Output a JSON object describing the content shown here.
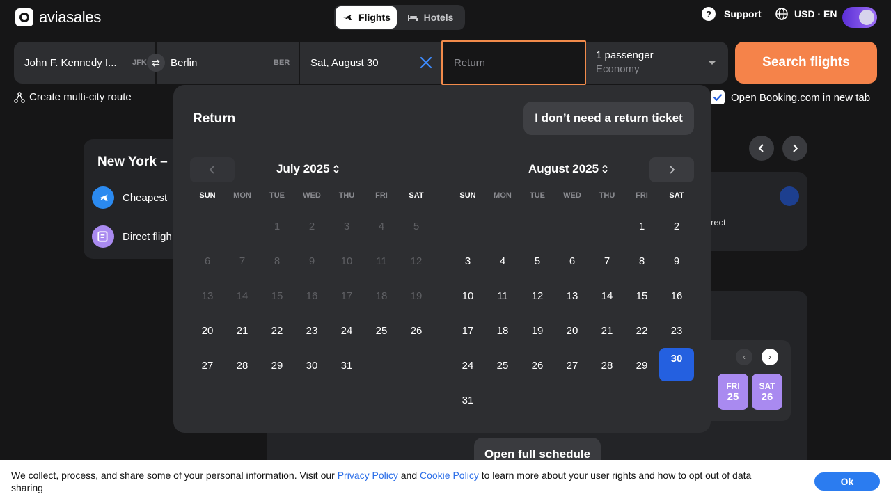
{
  "header": {
    "logo_text": "aviasales",
    "tabs": [
      {
        "label": "Flights",
        "active": true
      },
      {
        "label": "Hotels",
        "active": false
      }
    ],
    "support_label": "Support",
    "locale_label": "USD · EN"
  },
  "search": {
    "origin": "John F. Kennedy I...",
    "origin_code": "JFK",
    "destination": "Berlin",
    "destination_code": "BER",
    "depart_date": "Sat, August 30",
    "return_placeholder": "Return",
    "passengers": "1 passenger",
    "cabin_class": "Economy",
    "submit_label": "Search flights"
  },
  "options": {
    "multicity_label": "Create multi-city route",
    "booking_label": "Open Booking.com in new tab",
    "booking_checked": true
  },
  "background": {
    "card_title": "New York –",
    "row1_label": "Cheapest",
    "row2_label": "Direct fligh",
    "right_card_text": "rect",
    "chips": [
      {
        "dow": "FRI",
        "day": "25"
      },
      {
        "dow": "SAT",
        "day": "26"
      }
    ],
    "schedule_label": "Open full schedule"
  },
  "calendar": {
    "title": "Return",
    "no_return_label": "I don’t need a return ticket",
    "weekdays": [
      "SUN",
      "MON",
      "TUE",
      "WED",
      "THU",
      "FRI",
      "SAT"
    ],
    "months": [
      {
        "label": "July 2025",
        "first_weekday": 2,
        "days": 31,
        "past_until": 20
      },
      {
        "label": "August 2025",
        "first_weekday": 5,
        "days": 31,
        "past_until": 0,
        "selected": 30
      }
    ]
  },
  "cookie": {
    "text_before": "We collect, process, and share some of your personal information. Visit our ",
    "privacy_link": "Privacy Policy",
    "text_and": " and ",
    "cookie_link": "Cookie Policy",
    "text_after": " to learn more about your user rights and how to opt out of data sharing",
    "ok_label": "Ok"
  },
  "colors": {
    "accent_orange": "#f5834a",
    "selected_blue": "#2460e0",
    "link_blue": "#2b6ee8"
  }
}
